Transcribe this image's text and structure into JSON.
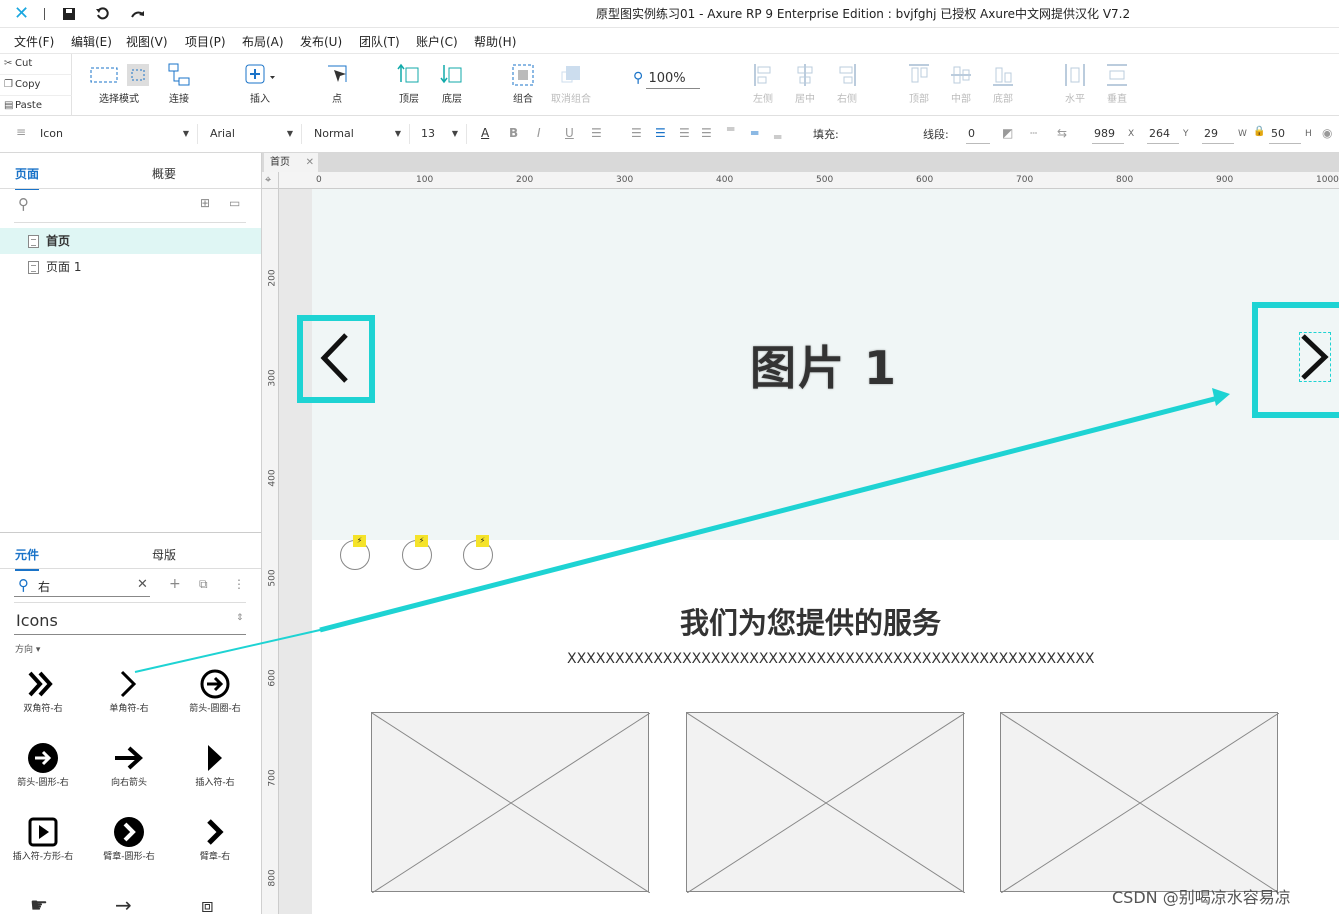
{
  "titlebar": {
    "title": "原型图实例练习01 - Axure RP 9 Enterprise Edition : bvjfghj 已授权      Axure中文网提供汉化 V7.2"
  },
  "menu": [
    "文件(F)",
    "编辑(E)",
    "视图(V)",
    "项目(P)",
    "布局(A)",
    "发布(U)",
    "团队(T)",
    "账户(C)",
    "帮助(H)"
  ],
  "clipboard": {
    "cut": "Cut",
    "copy": "Copy",
    "paste": "Paste"
  },
  "toolbar": {
    "select_mode": "选择模式",
    "connect": "连接",
    "insert": "插入",
    "point": "点",
    "front": "顶层",
    "back": "底层",
    "group": "组合",
    "ungroup": "取消组合",
    "zoom": "100%",
    "align_left": "左侧",
    "align_center": "居中",
    "align_right": "右侧",
    "align_top": "顶部",
    "align_middle": "中部",
    "align_bottom": "底部",
    "dist_h": "水平",
    "dist_v": "垂直"
  },
  "format": {
    "style": "Icon",
    "font": "Arial",
    "weight": "Normal",
    "size": "13",
    "fill_label": "填充:",
    "line_label": "线段:",
    "line_value": "0",
    "x": "989",
    "x_lbl": "X",
    "y": "264",
    "y_lbl": "Y",
    "w": "29",
    "w_lbl": "W",
    "h": "50",
    "h_lbl": "H"
  },
  "left": {
    "tab_pages": "页面",
    "tab_outline": "概要",
    "pages": [
      "首页",
      "页面 1"
    ],
    "tab_widgets": "元件",
    "tab_masters": "母版",
    "search_value": "右",
    "library": "Icons",
    "group": "方向",
    "icons": [
      {
        "glyph": "»",
        "cap": "双角符-右"
      },
      {
        "glyph": "›",
        "cap": "单角符-右"
      },
      {
        "glyph": "➔",
        "cap": "箭头-圆圈-右"
      },
      {
        "glyph": "➜",
        "cap": "箭头-圆形-右"
      },
      {
        "glyph": "→",
        "cap": "向右箭头"
      },
      {
        "glyph": "▶",
        "cap": "插入符-右"
      },
      {
        "glyph": "▶",
        "cap": "插入符-方形-右"
      },
      {
        "glyph": "›",
        "cap": "臂章-圆形-右"
      },
      {
        "glyph": "›",
        "cap": "臂章-右"
      }
    ]
  },
  "canvas": {
    "tab": "首页",
    "hero_title": "图片 1",
    "services_title": "我们为您提供的服务",
    "services_sub": "XXXXXXXXXXXXXXXXXXXXXXXXXXXXXXXXXXXXXXXXXXXXXXXXXXXXXXX",
    "hruler": [
      "0",
      "100",
      "200",
      "300",
      "400",
      "500",
      "600",
      "700",
      "800",
      "900",
      "1000"
    ],
    "vruler": [
      "200",
      "300",
      "400",
      "500",
      "600",
      "700",
      "800"
    ]
  },
  "highlight_color": "#1ed3d3",
  "watermark": "CSDN @别喝凉水容易凉"
}
